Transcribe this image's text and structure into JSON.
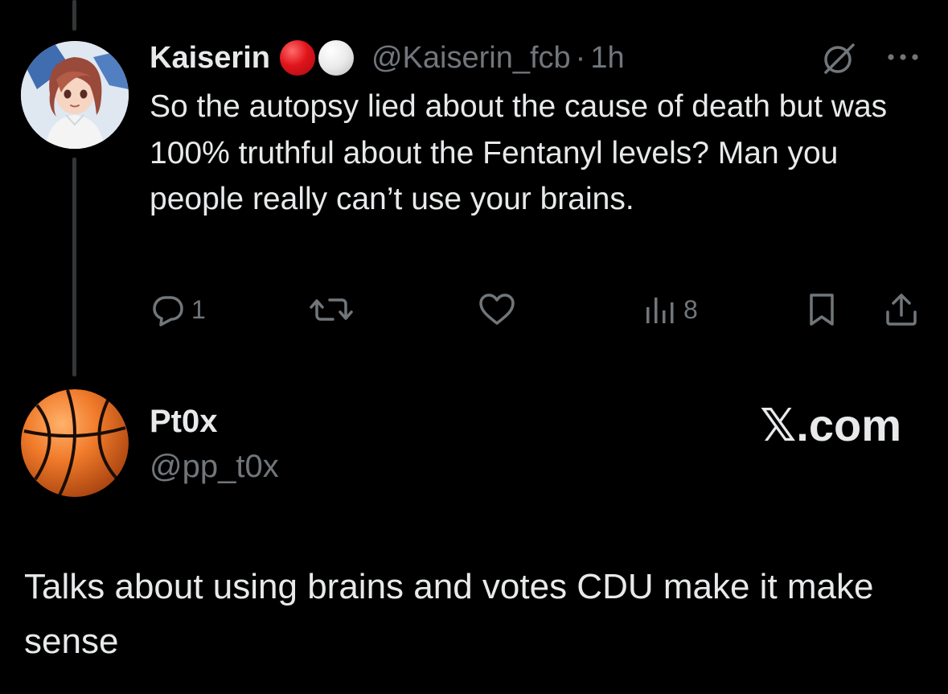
{
  "original_tweet": {
    "display_name": "Kaiserin",
    "handle": "@Kaiserin_fcb",
    "separator": "·",
    "time": "1h",
    "text": "So the autopsy lied about the cause of death but was 100% truthful about the Fentanyl levels? Man you people really can’t use your brains.",
    "badge_emojis": [
      "red-circle",
      "white-circle"
    ],
    "actions": {
      "reply_count": "1",
      "retweet_count": "",
      "like_count": "",
      "views_count": "8"
    }
  },
  "quote": {
    "display_name": "Pt0x",
    "handle": "@pp_t0x",
    "brand": "𝕏.com",
    "text": "Talks about using brains and votes CDU make it make sense"
  },
  "colors": {
    "background": "#000000",
    "text_primary": "#e7e9ea",
    "text_secondary": "#71767b",
    "thread_line": "#333639"
  }
}
